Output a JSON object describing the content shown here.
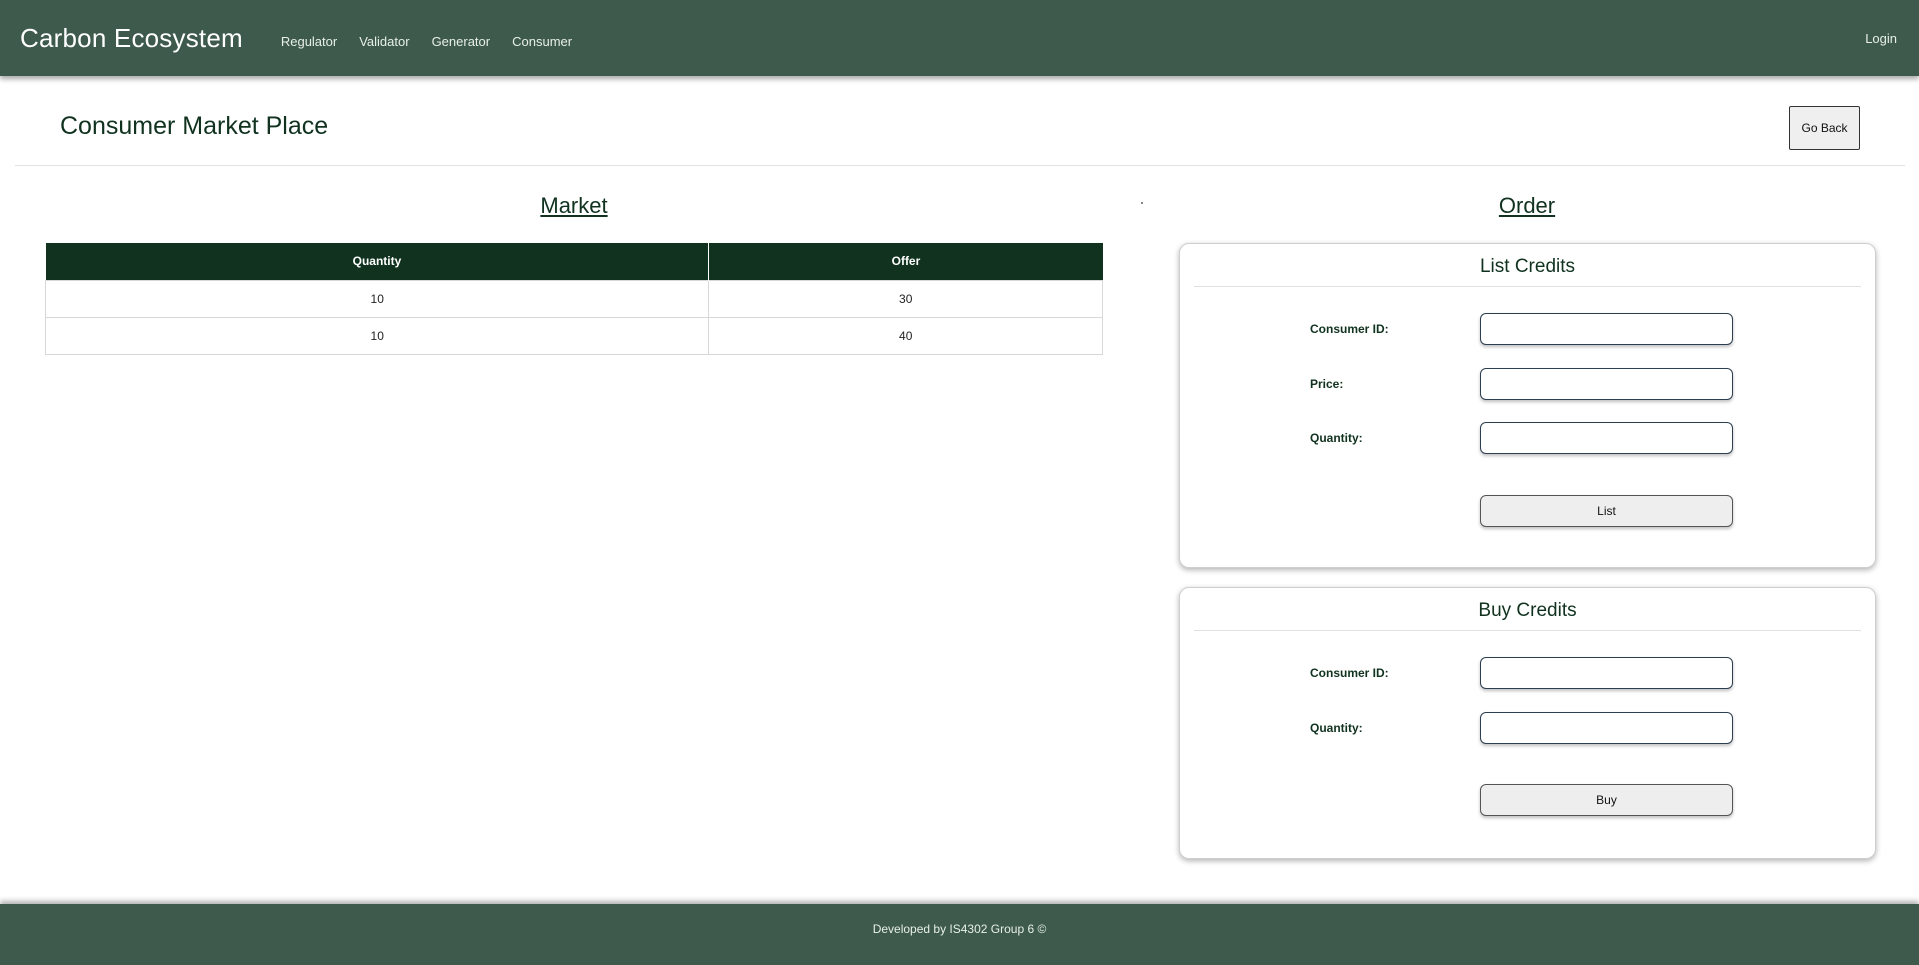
{
  "navbar": {
    "brand": "Carbon Ecosystem",
    "links": [
      "Regulator",
      "Validator",
      "Generator",
      "Consumer"
    ],
    "login": "Login"
  },
  "page": {
    "title": "Consumer Market Place",
    "go_back": "Go Back"
  },
  "market": {
    "title": "Market",
    "columns": [
      "Quantity",
      "Offer"
    ],
    "rows": [
      [
        "10",
        "30"
      ],
      [
        "10",
        "40"
      ]
    ]
  },
  "order": {
    "title": "Order",
    "list_credits": {
      "title": "List Credits",
      "consumer_id_label": "Consumer ID:",
      "consumer_id_value": "",
      "price_label": "Price:",
      "price_value": "",
      "quantity_label": "Quantity:",
      "quantity_value": "",
      "button": "List"
    },
    "buy_credits": {
      "title": "Buy Credits",
      "consumer_id_label": "Consumer ID:",
      "consumer_id_value": "",
      "quantity_label": "Quantity:",
      "quantity_value": "",
      "button": "Buy"
    }
  },
  "footer": {
    "text": "Developed by IS4302 Group 6 ©"
  },
  "colors": {
    "nav_bg": "#3d5a4c",
    "dark_green": "#10321f",
    "footer_bg": "#3d5a4c"
  }
}
